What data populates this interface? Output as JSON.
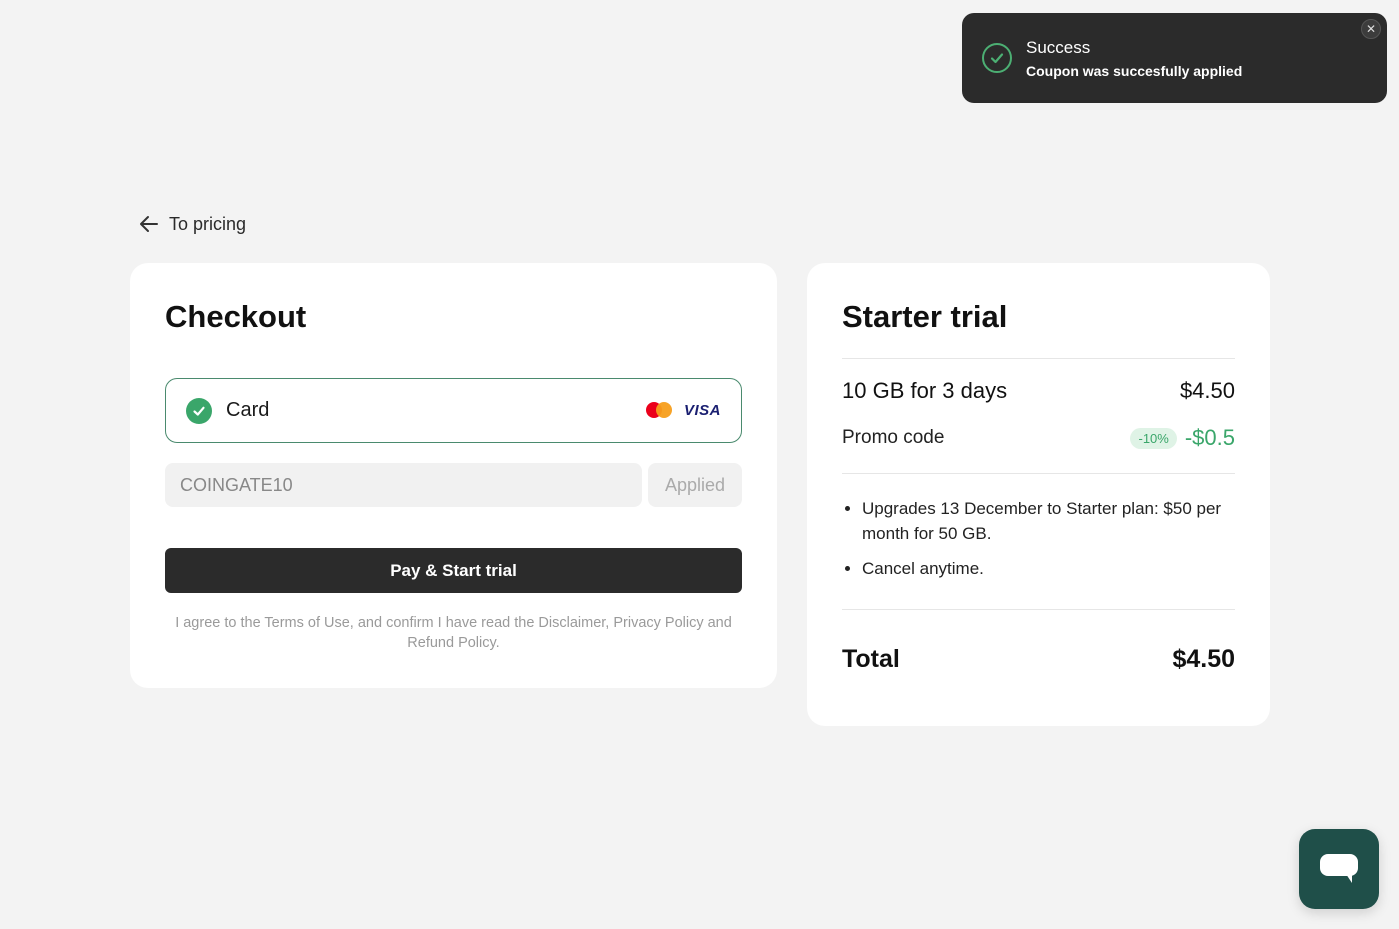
{
  "toast": {
    "title": "Success",
    "message": "Coupon was succesfully applied",
    "close_glyph": "✕"
  },
  "nav": {
    "back_label": "To pricing"
  },
  "checkout": {
    "title": "Checkout",
    "payment_method": {
      "label": "Card",
      "selected": true,
      "brands": [
        "mastercard",
        "VISA"
      ]
    },
    "promo": {
      "value": "COINGATE10",
      "button_label": "Applied"
    },
    "pay_button_label": "Pay & Start trial",
    "terms_text": "I agree to the Terms of Use, and confirm I have read the Disclaimer, Privacy Policy and Refund Policy."
  },
  "summary": {
    "title": "Starter trial",
    "item": {
      "label": "10 GB for 3 days",
      "price": "$4.50"
    },
    "promo": {
      "label": "Promo code",
      "badge": "-10%",
      "discount": "-$0.5"
    },
    "bullets": [
      "Upgrades 13 December to Starter plan: $50 per month for 50 GB.",
      "Cancel anytime."
    ],
    "total": {
      "label": "Total",
      "value": "$4.50"
    }
  },
  "colors": {
    "accent_green": "#3aa66a",
    "dark": "#2b2b2b",
    "chat_bg": "#1f4f49"
  },
  "icons": {
    "toast": "check-circle-icon",
    "back": "arrow-left-icon",
    "chat": "chat-bubble-icon"
  }
}
